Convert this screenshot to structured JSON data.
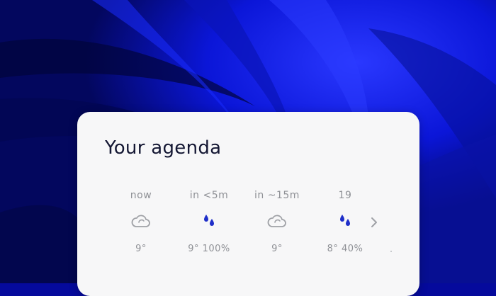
{
  "agenda": {
    "title": "Your agenda",
    "forecast": [
      {
        "label": "now",
        "icon": "cloud-icon",
        "value": "9°"
      },
      {
        "label": "in <5m",
        "icon": "raindrops-icon",
        "value": "9° 100%"
      },
      {
        "label": "in ~15m",
        "icon": "cloud-icon",
        "value": "9°"
      },
      {
        "label": "19",
        "icon": "raindrops-icon",
        "value": "8° 40%"
      }
    ],
    "next_icon": "chevron-right-icon"
  },
  "colors": {
    "background": "#050a9c",
    "card": "#f7f7f8",
    "title": "#141733",
    "muted_text": "#8f9196",
    "rain_blue": "#1f2fc9"
  }
}
